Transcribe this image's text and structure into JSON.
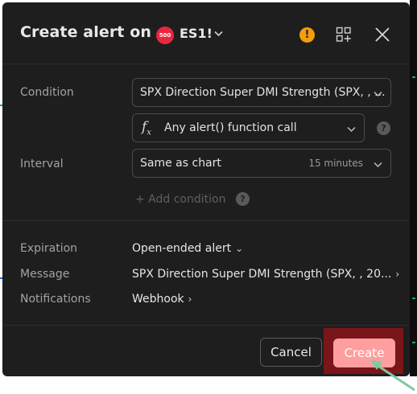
{
  "dialog": {
    "title": "Create alert on",
    "symbol": {
      "badge": "500",
      "name": "ES1!"
    }
  },
  "condition": {
    "label": "Condition",
    "indicator": "SPX Direction Super DMI Strength (SPX, , ...",
    "trigger": "Any alert() function call"
  },
  "interval": {
    "label": "Interval",
    "value": "Same as chart",
    "hint": "15 minutes"
  },
  "add_condition": "+ Add condition",
  "details": {
    "expiration": {
      "label": "Expiration",
      "value": "Open-ended alert"
    },
    "message": {
      "label": "Message",
      "value": "SPX Direction Super DMI Strength (SPX, , 20..."
    },
    "notifications": {
      "label": "Notifications",
      "value": "Webhook"
    }
  },
  "footer": {
    "cancel_label": "Cancel",
    "create_label": "Create"
  },
  "colors": {
    "dialog_bg": "#1e1e1e",
    "create_button": "#ff9e9e",
    "highlight": "#7a1519",
    "warning": "#f59d0d",
    "badge": "#e8273f",
    "pointer": "#7fc9a0"
  },
  "icons": [
    "warning-icon",
    "grid-plus-icon",
    "close-icon",
    "fx-icon",
    "help-icon",
    "chevron-down-icon",
    "chevron-right-icon"
  ]
}
